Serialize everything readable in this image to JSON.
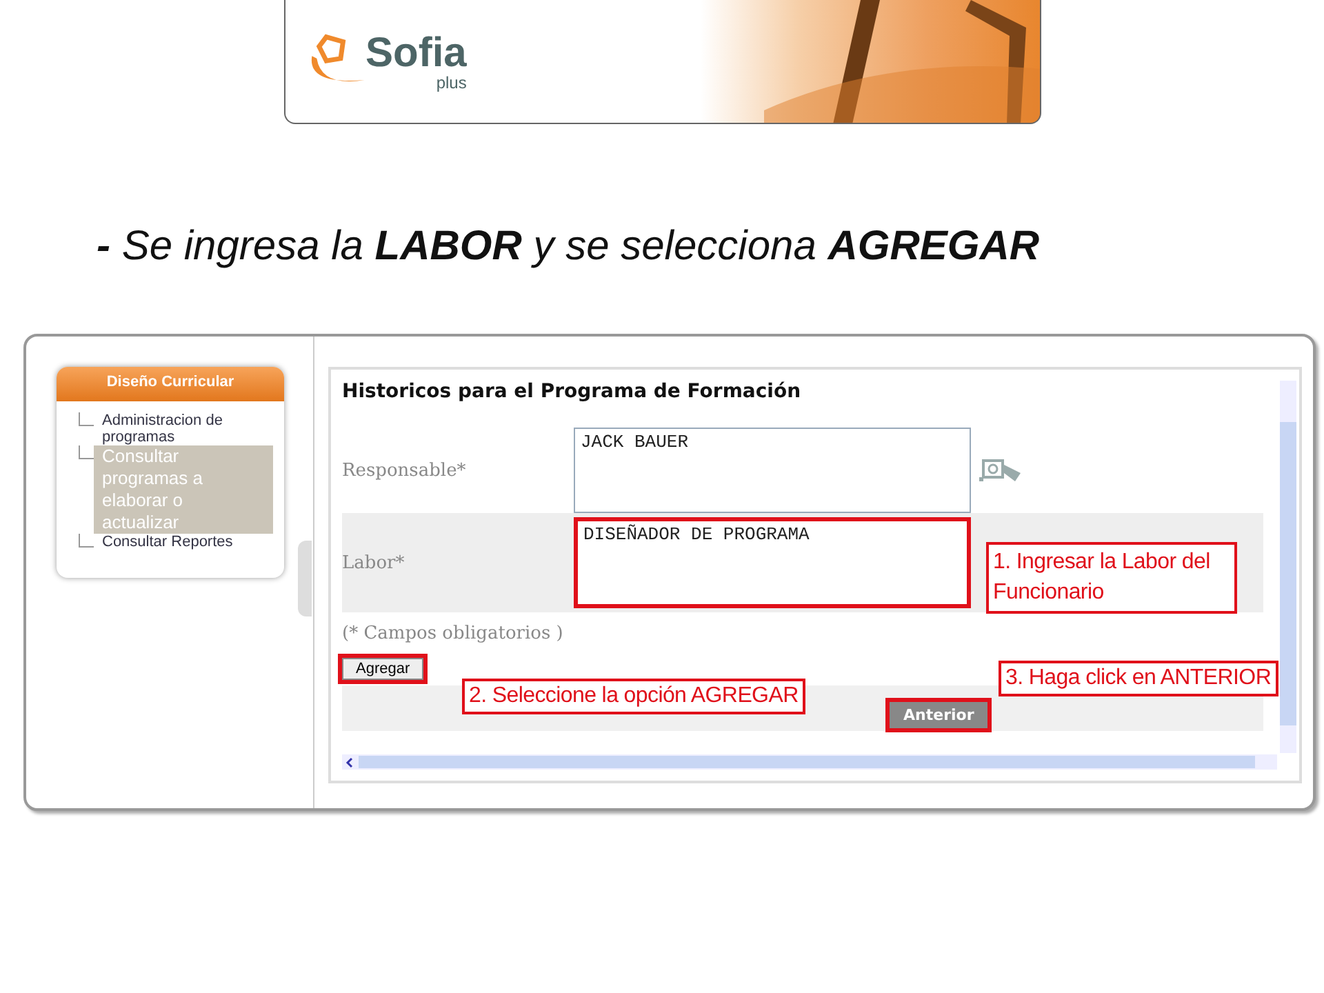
{
  "header": {
    "logo_text": "Sofia",
    "logo_subtext": "plus"
  },
  "heading": "**-** Se ingresa la **LABOR** y se selecciona **AGREGAR**",
  "sidebar": {
    "title": "Diseño Curricular",
    "items": [
      {
        "label": "Administracion de programas",
        "selected": false
      },
      {
        "label": "Consultar programas a elaborar o actualizar",
        "selected": true
      },
      {
        "label": "Consultar Reportes",
        "selected": false
      }
    ]
  },
  "form": {
    "title": "Historicos para el Programa de Formación",
    "fields": [
      {
        "label": "Responsable*",
        "value": "JACK BAUER",
        "highlighted": false
      },
      {
        "label": "Labor*",
        "value": "DISEÑADOR DE PROGRAMA",
        "highlighted": true
      }
    ],
    "note": "(* Campos obligatorios )",
    "add_button": {
      "label": "Agregar",
      "highlighted": true
    },
    "back_button": {
      "label": "Anterior",
      "highlighted": true
    }
  },
  "annotations": [
    "1. Ingresar la Labor del Funcionario",
    "2. Seleccione la opción AGREGAR",
    "3. Haga click en ANTERIOR"
  ]
}
